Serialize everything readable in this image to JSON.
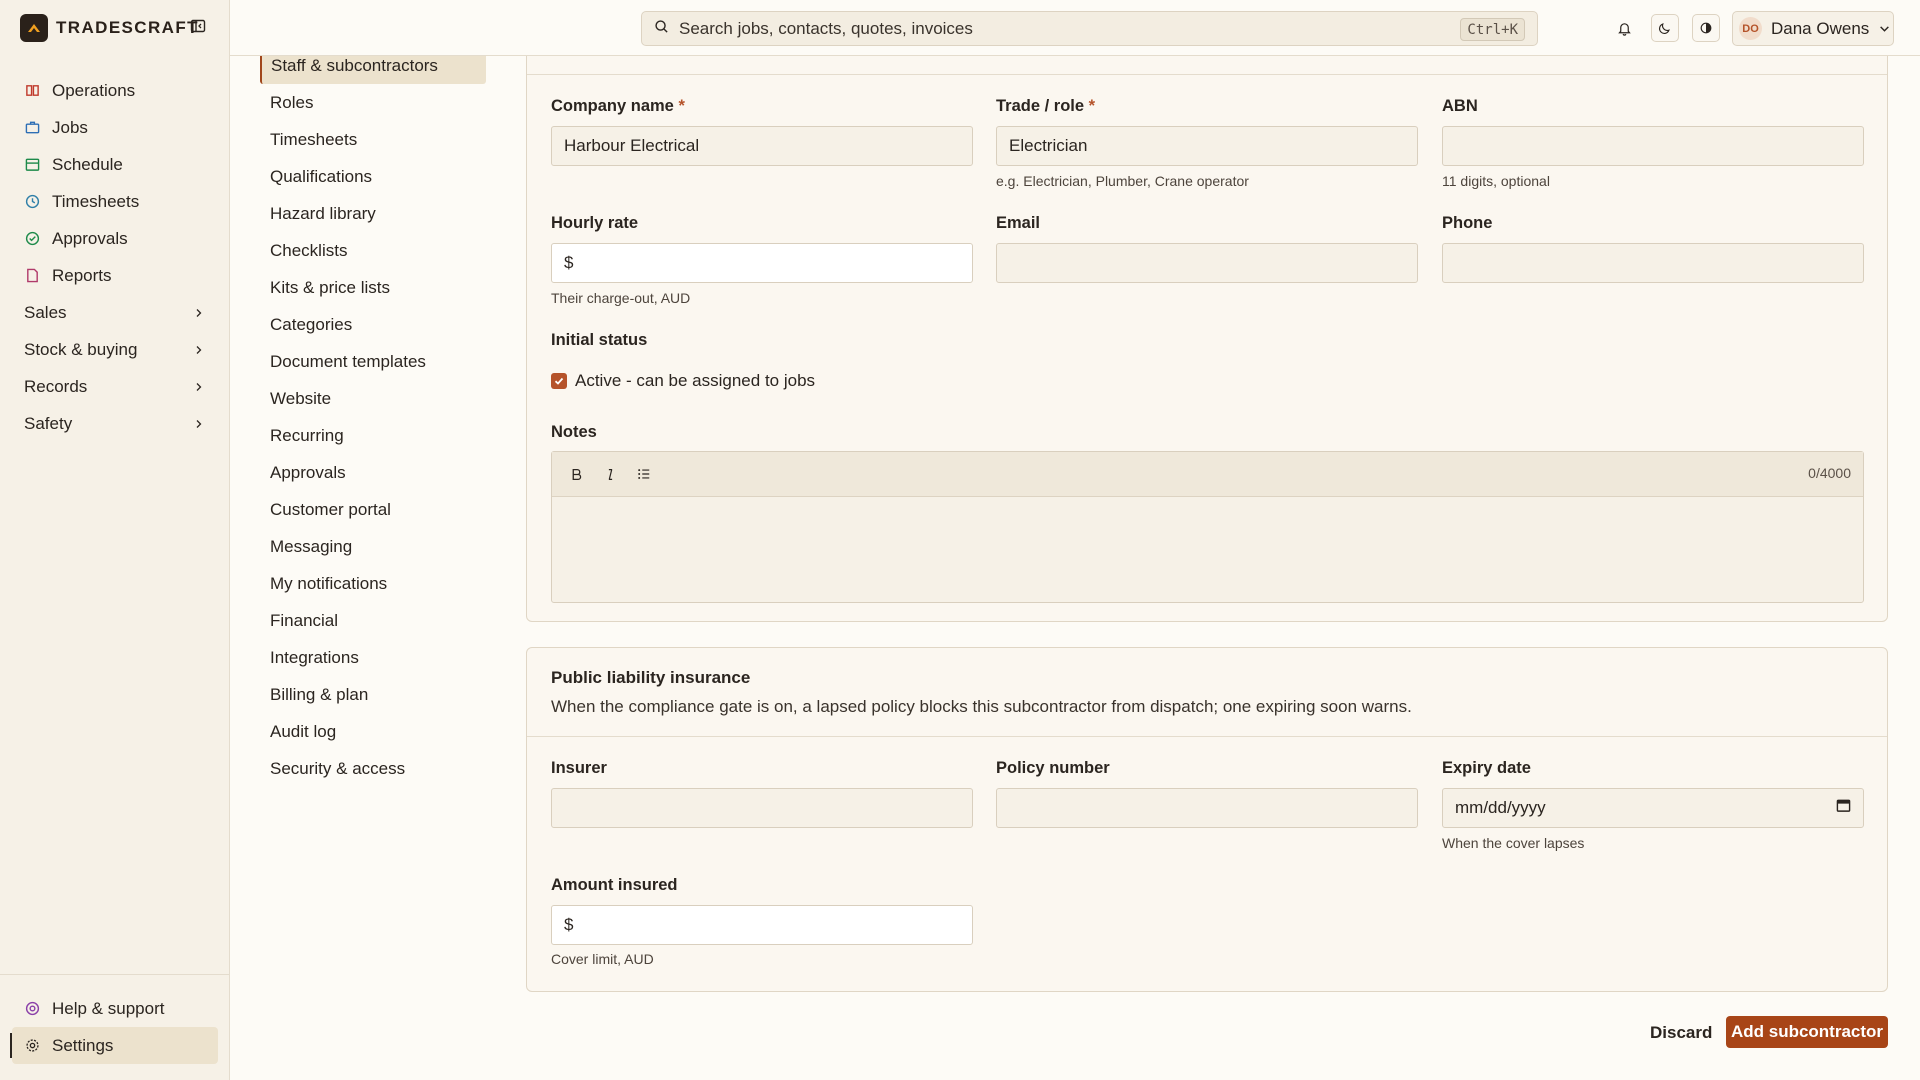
{
  "brand": {
    "name": "TRADESCRAFT"
  },
  "search": {
    "placeholder": "Search jobs, contacts, quotes, invoices",
    "shortcut": "Ctrl+K"
  },
  "user": {
    "initials": "DO",
    "name": "Dana Owens"
  },
  "sidebar": {
    "items": [
      {
        "label": "Operations",
        "icon": "book-icon",
        "color": "#c0392b"
      },
      {
        "label": "Jobs",
        "icon": "briefcase-icon",
        "color": "#2e6fb5"
      },
      {
        "label": "Schedule",
        "icon": "calendar-icon",
        "color": "#1e8a4a"
      },
      {
        "label": "Timesheets",
        "icon": "clock-icon",
        "color": "#2f7fa8"
      },
      {
        "label": "Approvals",
        "icon": "check-circle-icon",
        "color": "#1e8a4a"
      },
      {
        "label": "Reports",
        "icon": "file-icon",
        "color": "#b03a6a"
      }
    ],
    "groups": [
      {
        "label": "Sales"
      },
      {
        "label": "Stock & buying"
      },
      {
        "label": "Records"
      },
      {
        "label": "Safety"
      }
    ],
    "bottom": [
      {
        "label": "Help & support",
        "icon": "lifebuoy-icon",
        "color": "#8a3fa8"
      },
      {
        "label": "Settings",
        "icon": "gear-icon",
        "color": "#2b2520"
      }
    ]
  },
  "subnav": {
    "items": [
      "Staff & subcontractors",
      "Roles",
      "Timesheets",
      "Qualifications",
      "Hazard library",
      "Checklists",
      "Kits & price lists",
      "Categories",
      "Document templates",
      "Website",
      "Recurring",
      "Approvals",
      "Customer portal",
      "Messaging",
      "My notifications",
      "Financial",
      "Integrations",
      "Billing & plan",
      "Audit log",
      "Security & access"
    ],
    "active_index": 0
  },
  "form": {
    "company_name": {
      "label": "Company name",
      "value": "Harbour Electrical"
    },
    "trade_role": {
      "label": "Trade / role",
      "value": "Electrician",
      "hint": "e.g. Electrician, Plumber, Crane operator"
    },
    "abn": {
      "label": "ABN",
      "value": "",
      "hint": "11 digits, optional"
    },
    "hourly_rate": {
      "label": "Hourly rate",
      "prefix": "$",
      "value": "",
      "hint": "Their charge-out, AUD"
    },
    "email": {
      "label": "Email",
      "value": ""
    },
    "phone": {
      "label": "Phone",
      "value": ""
    },
    "initial_status": {
      "label": "Initial status",
      "checkbox_label": "Active - can be assigned to jobs",
      "checked": true
    },
    "notes": {
      "label": "Notes",
      "counter": "0/4000"
    },
    "required_marker": "*"
  },
  "insurance": {
    "title": "Public liability insurance",
    "description": "When the compliance gate is on, a lapsed policy blocks this subcontractor from dispatch; one expiring soon warns.",
    "insurer": {
      "label": "Insurer",
      "value": ""
    },
    "policy_number": {
      "label": "Policy number",
      "value": ""
    },
    "expiry_date": {
      "label": "Expiry date",
      "placeholder": "mm/dd/yyyy",
      "hint": "When the cover lapses"
    },
    "amount_insured": {
      "label": "Amount insured",
      "prefix": "$",
      "value": "",
      "hint": "Cover limit, AUD"
    }
  },
  "actions": {
    "discard": "Discard",
    "submit": "Add subcontractor"
  },
  "colors": {
    "accent": "#a84517",
    "background": "#fdfbf6",
    "sidebar": "#f6f1e7"
  }
}
